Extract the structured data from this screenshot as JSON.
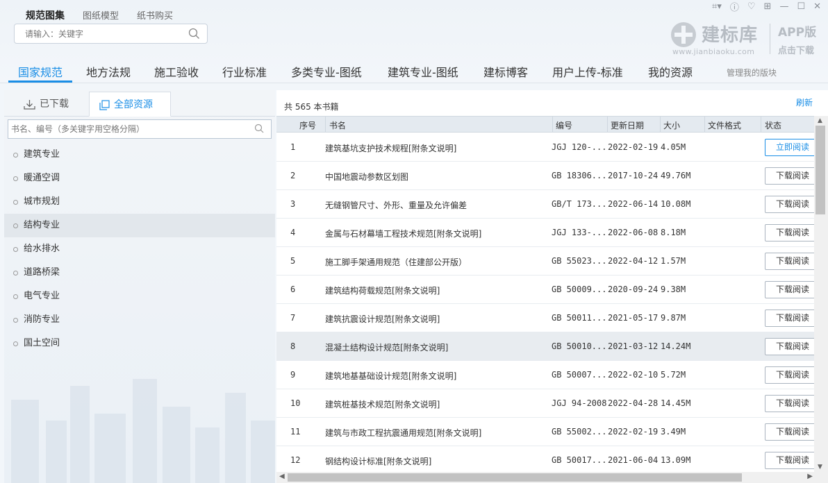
{
  "header": {
    "tabs": [
      "规范图集",
      "图纸模型",
      "纸书购买"
    ],
    "search_placeholder": "请输入：关键字",
    "brand": {
      "name": "建标库",
      "url": "www.jianbiaoku.com",
      "app": "APP版",
      "download": "点击下载"
    }
  },
  "nav": {
    "items": [
      "国家规范",
      "地方法规",
      "施工验收",
      "行业标准",
      "多类专业-图纸",
      "建筑专业-图纸",
      "建标博客",
      "用户上传-标准",
      "我的资源"
    ],
    "manage": "管理我的版块"
  },
  "left": {
    "tab_downloaded": "已下载",
    "tab_all": "全部资源",
    "search_placeholder": "书名、编号（多关键字用空格分隔）",
    "categories": [
      "建筑专业",
      "暖通空调",
      "城市规划",
      "结构专业",
      "给水排水",
      "道路桥梁",
      "电气专业",
      "消防专业",
      "国土空间"
    ]
  },
  "right": {
    "count": "共 565 本书籍",
    "refresh": "刷新",
    "columns": [
      "序号",
      "书名",
      "编号",
      "更新日期",
      "大小",
      "文件格式",
      "状态"
    ],
    "rows": [
      {
        "no": "1",
        "title": "建筑基坑支护技术规程[附条文说明]",
        "code": "JGJ 120-...",
        "date": "2022-02-19",
        "size": "4.05M",
        "action": "立即阅读"
      },
      {
        "no": "2",
        "title": "中国地震动参数区划图",
        "code": "GB 18306...",
        "date": "2017-10-24",
        "size": "49.76M",
        "action": "下载阅读"
      },
      {
        "no": "3",
        "title": "无缝钢管尺寸、外形、重量及允许偏差",
        "code": "GB/T 173...",
        "date": "2022-06-14",
        "size": "10.08M",
        "action": "下载阅读"
      },
      {
        "no": "4",
        "title": "金属与石材幕墙工程技术规范[附条文说明]",
        "code": "JGJ 133-...",
        "date": "2022-06-08",
        "size": "8.18M",
        "action": "下载阅读"
      },
      {
        "no": "5",
        "title": "施工脚手架通用规范（住建部公开版）",
        "code": "GB 55023...",
        "date": "2022-04-12",
        "size": "1.57M",
        "action": "下载阅读"
      },
      {
        "no": "6",
        "title": "建筑结构荷载规范[附条文说明]",
        "code": "GB 50009...",
        "date": "2020-09-24",
        "size": "9.38M",
        "action": "下载阅读"
      },
      {
        "no": "7",
        "title": "建筑抗震设计规范[附条文说明]",
        "code": "GB 50011...",
        "date": "2021-05-17",
        "size": "9.87M",
        "action": "下载阅读"
      },
      {
        "no": "8",
        "title": "混凝土结构设计规范[附条文说明]",
        "code": "GB 50010...",
        "date": "2021-03-12",
        "size": "14.24M",
        "action": "下载阅读"
      },
      {
        "no": "9",
        "title": "建筑地基基础设计规范[附条文说明]",
        "code": "GB 50007...",
        "date": "2022-02-10",
        "size": "5.72M",
        "action": "下载阅读"
      },
      {
        "no": "10",
        "title": "建筑桩基技术规范[附条文说明]",
        "code": "JGJ 94-2008",
        "date": "2022-04-28",
        "size": "14.45M",
        "action": "下载阅读"
      },
      {
        "no": "11",
        "title": "建筑与市政工程抗震通用规范[附条文说明]",
        "code": "GB 55002...",
        "date": "2022-02-19",
        "size": "3.49M",
        "action": "下载阅读"
      },
      {
        "no": "12",
        "title": "钢结构设计标准[附条文说明]",
        "code": "GB 50017...",
        "date": "2021-06-04",
        "size": "13.09M",
        "action": "下载阅读"
      }
    ]
  },
  "colors": {
    "accent": "#1a8ee6"
  }
}
